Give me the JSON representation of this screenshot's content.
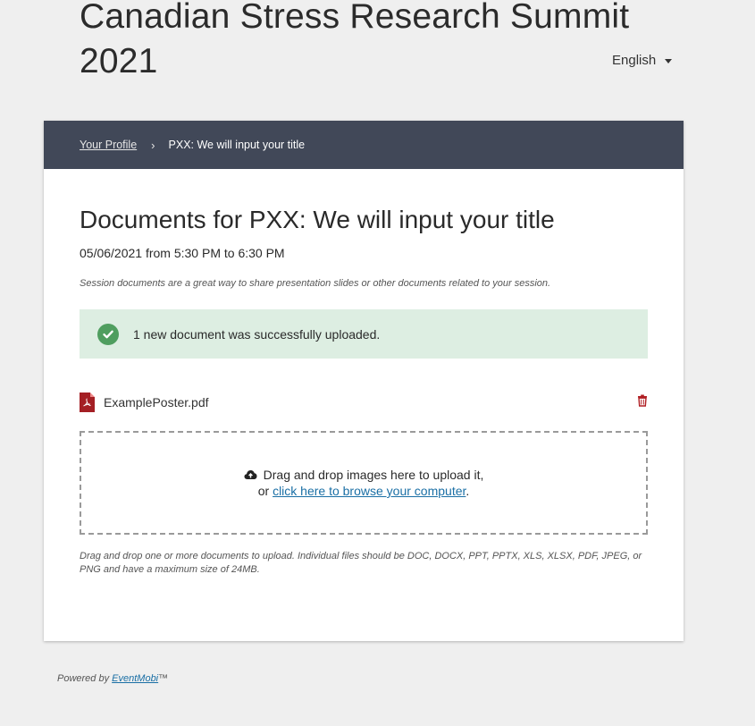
{
  "header": {
    "event_title": "Canadian Stress Research Summit 2021",
    "language": "English"
  },
  "breadcrumb": {
    "profile_link": "Your Profile",
    "separator": "›",
    "current": "PXX: We will input your title"
  },
  "main": {
    "title": "Documents for PXX: We will input your title",
    "session_time": "05/06/2021 from 5:30 PM to 6:30 PM",
    "intro_hint": "Session documents are a great way to share presentation slides or other documents related to your session.",
    "success_message": "1 new document was successfully uploaded.",
    "files": [
      {
        "name": "ExamplePoster.pdf",
        "icon": "pdf-file-icon"
      }
    ],
    "dropzone": {
      "line1": "Drag and drop images here to upload it,",
      "line2_prefix": "or ",
      "browse_link": "click here to browse your computer",
      "line2_suffix": "."
    },
    "upload_hint": "Drag and drop one or more documents to upload. Individual files should be DOC, DOCX, PPT, PPTX, XLS, XLSX, PDF, JPEG, or PNG and have a maximum size of 24MB."
  },
  "footer": {
    "powered_prefix": "Powered by ",
    "brand_link": "EventMobi",
    "trademark": "™"
  },
  "colors": {
    "breadcrumb_bg": "#414858",
    "success_bg": "#ddeee2",
    "success_icon": "#4f9e5f",
    "pdf_icon": "#a41f24",
    "link": "#1a6fa5"
  }
}
